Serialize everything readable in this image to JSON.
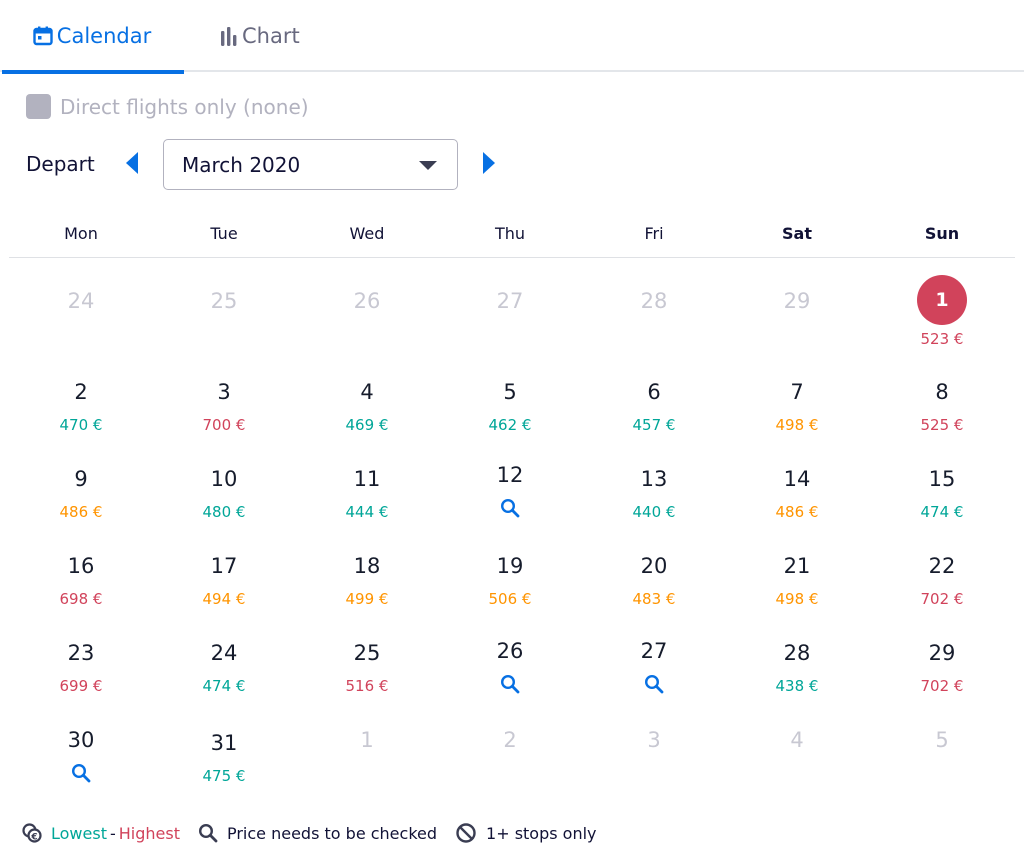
{
  "tabs": {
    "calendar": "Calendar",
    "chart": "Chart"
  },
  "filters": {
    "direct_only": "Direct flights only (none)",
    "direct_checked": false
  },
  "depart": {
    "label": "Depart",
    "month": "March 2020"
  },
  "weekdays": [
    "Mon",
    "Tue",
    "Wed",
    "Thu",
    "Fri",
    "Sat",
    "Sun"
  ],
  "colors": {
    "accent": "#0770e3",
    "lowest": "#00a698",
    "mid": "#ff9400",
    "highest": "#d1435b",
    "muted": "#c8c8d2"
  },
  "calendar": {
    "weeks": [
      [
        {
          "day": "24",
          "muted": true
        },
        {
          "day": "25",
          "muted": true
        },
        {
          "day": "26",
          "muted": true
        },
        {
          "day": "27",
          "muted": true
        },
        {
          "day": "28",
          "muted": true
        },
        {
          "day": "29",
          "muted": true
        },
        {
          "day": "1",
          "price": "523 €",
          "level": "red",
          "selected": true
        }
      ],
      [
        {
          "day": "2",
          "price": "470 €",
          "level": "green"
        },
        {
          "day": "3",
          "price": "700 €",
          "level": "red"
        },
        {
          "day": "4",
          "price": "469 €",
          "level": "green"
        },
        {
          "day": "5",
          "price": "462 €",
          "level": "green"
        },
        {
          "day": "6",
          "price": "457 €",
          "level": "green"
        },
        {
          "day": "7",
          "price": "498 €",
          "level": "orange"
        },
        {
          "day": "8",
          "price": "525 €",
          "level": "red"
        }
      ],
      [
        {
          "day": "9",
          "price": "486 €",
          "level": "orange"
        },
        {
          "day": "10",
          "price": "480 €",
          "level": "green"
        },
        {
          "day": "11",
          "price": "444 €",
          "level": "green"
        },
        {
          "day": "12",
          "check": true
        },
        {
          "day": "13",
          "price": "440 €",
          "level": "green"
        },
        {
          "day": "14",
          "price": "486 €",
          "level": "orange"
        },
        {
          "day": "15",
          "price": "474 €",
          "level": "green"
        }
      ],
      [
        {
          "day": "16",
          "price": "698 €",
          "level": "red"
        },
        {
          "day": "17",
          "price": "494 €",
          "level": "orange"
        },
        {
          "day": "18",
          "price": "499 €",
          "level": "orange"
        },
        {
          "day": "19",
          "price": "506 €",
          "level": "orange"
        },
        {
          "day": "20",
          "price": "483 €",
          "level": "orange"
        },
        {
          "day": "21",
          "price": "498 €",
          "level": "orange"
        },
        {
          "day": "22",
          "price": "702 €",
          "level": "red"
        }
      ],
      [
        {
          "day": "23",
          "price": "699 €",
          "level": "red"
        },
        {
          "day": "24",
          "price": "474 €",
          "level": "green"
        },
        {
          "day": "25",
          "price": "516 €",
          "level": "red"
        },
        {
          "day": "26",
          "check": true
        },
        {
          "day": "27",
          "check": true
        },
        {
          "day": "28",
          "price": "438 €",
          "level": "green"
        },
        {
          "day": "29",
          "price": "702 €",
          "level": "red"
        }
      ],
      [
        {
          "day": "30",
          "check": true
        },
        {
          "day": "31",
          "price": "475 €",
          "level": "green"
        },
        {
          "day": "1",
          "muted": true
        },
        {
          "day": "2",
          "muted": true
        },
        {
          "day": "3",
          "muted": true
        },
        {
          "day": "4",
          "muted": true
        },
        {
          "day": "5",
          "muted": true
        }
      ]
    ]
  },
  "legend": {
    "lowest": "Lowest",
    "separator": "-",
    "highest": "Highest",
    "check": "Price needs to be checked",
    "stops": "1+ stops only"
  }
}
